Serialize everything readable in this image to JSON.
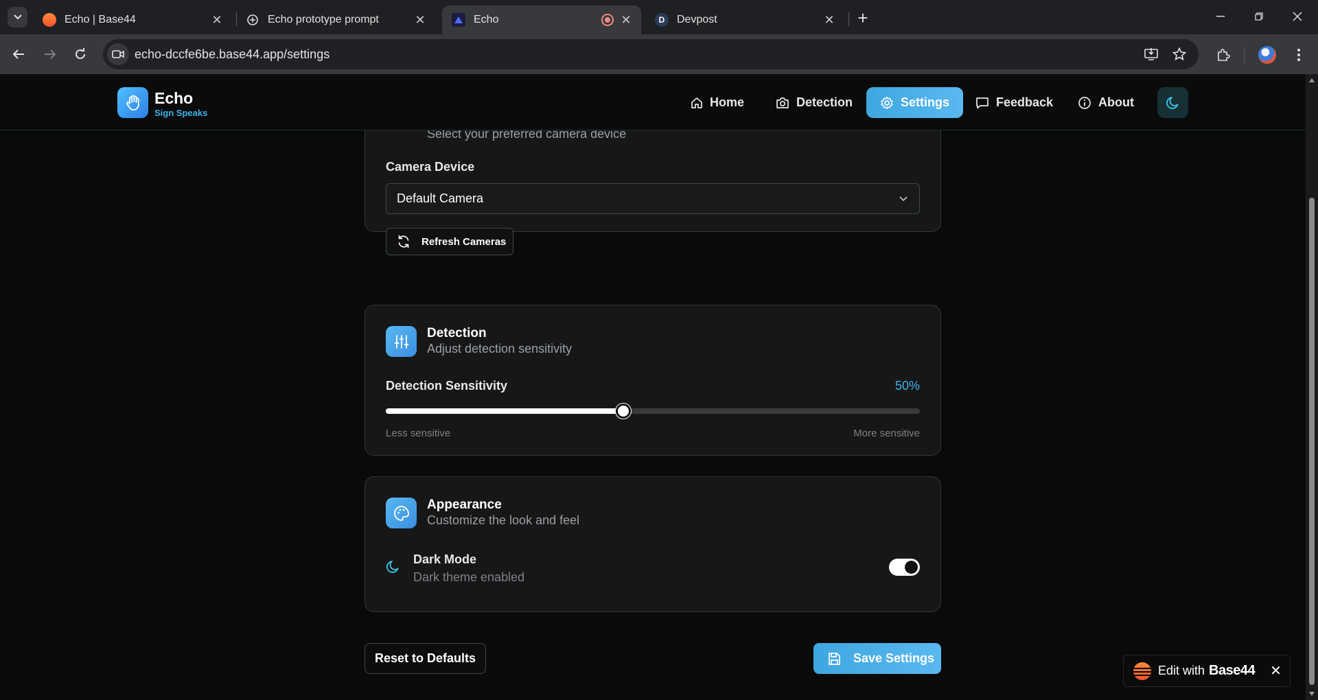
{
  "browser": {
    "tabs": [
      {
        "title": "Echo | Base44",
        "active": false
      },
      {
        "title": "Echo prototype prompt",
        "active": false
      },
      {
        "title": "Echo",
        "active": true
      },
      {
        "title": "Devpost",
        "active": false
      }
    ],
    "url": "echo-dccfe6be.base44.app/settings"
  },
  "header": {
    "brand_name": "Echo",
    "brand_tagline": "Sign Speaks",
    "nav": [
      {
        "label": "Home",
        "icon": "home-icon"
      },
      {
        "label": "Detection",
        "icon": "camera-icon"
      },
      {
        "label": "Settings",
        "icon": "gear-icon",
        "active": true
      },
      {
        "label": "Feedback",
        "icon": "message-icon"
      },
      {
        "label": "About",
        "icon": "info-icon"
      }
    ],
    "theme_toggle_icon": "moon-icon"
  },
  "camera_card": {
    "subtitle": "Select your preferred camera device",
    "field_label": "Camera Device",
    "selected_camera": "Default Camera",
    "refresh_label": "Refresh Cameras"
  },
  "detection_card": {
    "title": "Detection",
    "subtitle": "Adjust detection sensitivity",
    "field_label": "Detection Sensitivity",
    "value_label": "50%",
    "value": 0.5,
    "min_hint": "Less sensitive",
    "max_hint": "More sensitive"
  },
  "appearance_card": {
    "title": "Appearance",
    "subtitle": "Customize the look and feel",
    "dark_mode_label": "Dark Mode",
    "dark_mode_status": "Dark theme enabled",
    "dark_mode_on": true
  },
  "actions": {
    "reset_label": "Reset to Defaults",
    "save_label": "Save Settings"
  },
  "base44_badge": {
    "prefix": "Edit with",
    "brand": "Base44",
    "close": "✕"
  },
  "colors": {
    "accent": "#3fb3e8",
    "background": "#0a0a0b",
    "card": "#171718"
  }
}
